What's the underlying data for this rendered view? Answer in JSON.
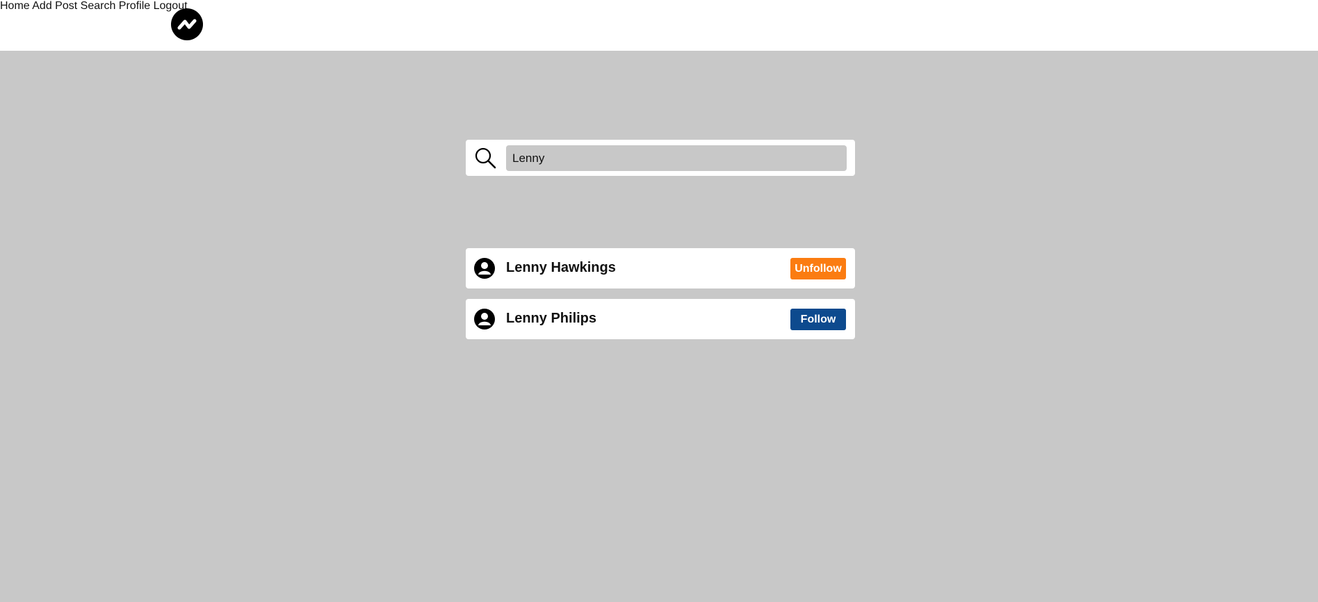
{
  "header": {
    "logo_icon": "trend-zigzag-logo-icon",
    "nav": [
      {
        "label": "Home"
      },
      {
        "label": "Add Post"
      },
      {
        "label": "Search"
      },
      {
        "label": "Profile"
      },
      {
        "label": "Logout"
      }
    ]
  },
  "search": {
    "icon": "search-icon",
    "value": "Lenny"
  },
  "results": [
    {
      "name": "Lenny Hawkings",
      "action_label": "Unfollow",
      "action_color": "#fb7c11",
      "avatar_icon": "user-avatar-icon"
    },
    {
      "name": "Lenny Philips",
      "action_label": "Follow",
      "action_color": "#0d4a8e",
      "avatar_icon": "user-avatar-icon"
    }
  ],
  "colors": {
    "page_background": "#c8c8c8",
    "header_background": "#ffffff",
    "unfollow_button": "#fb7c11",
    "follow_button": "#0d4a8e"
  }
}
